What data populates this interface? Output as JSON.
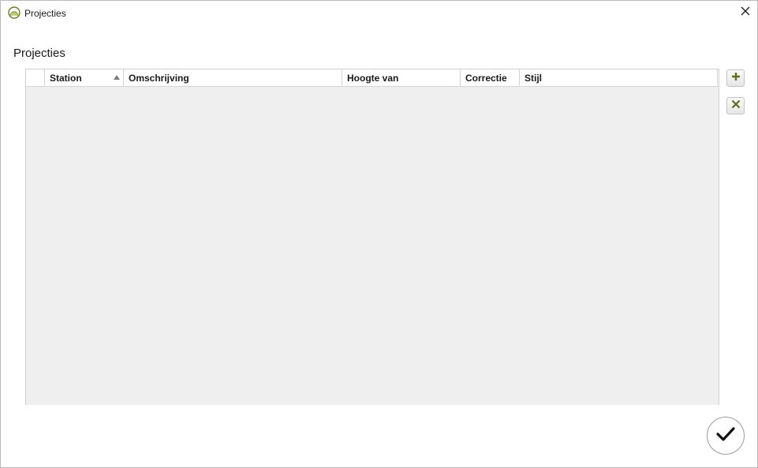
{
  "window": {
    "title": "Projecties",
    "icon": "rainbow-app-icon"
  },
  "section": {
    "title": "Projecties"
  },
  "grid": {
    "columns": [
      {
        "label": "Station",
        "sorted": "ascending"
      },
      {
        "label": "Omschrijving"
      },
      {
        "label": "Hoogte van"
      },
      {
        "label": "Correctie"
      },
      {
        "label": "Stijl"
      }
    ],
    "rows": []
  },
  "buttons": {
    "add": "plus-icon",
    "remove": "x-icon",
    "ok": "checkmark-icon"
  },
  "colors": {
    "accent": "#5a6e1e",
    "grid_background": "#efefef"
  }
}
